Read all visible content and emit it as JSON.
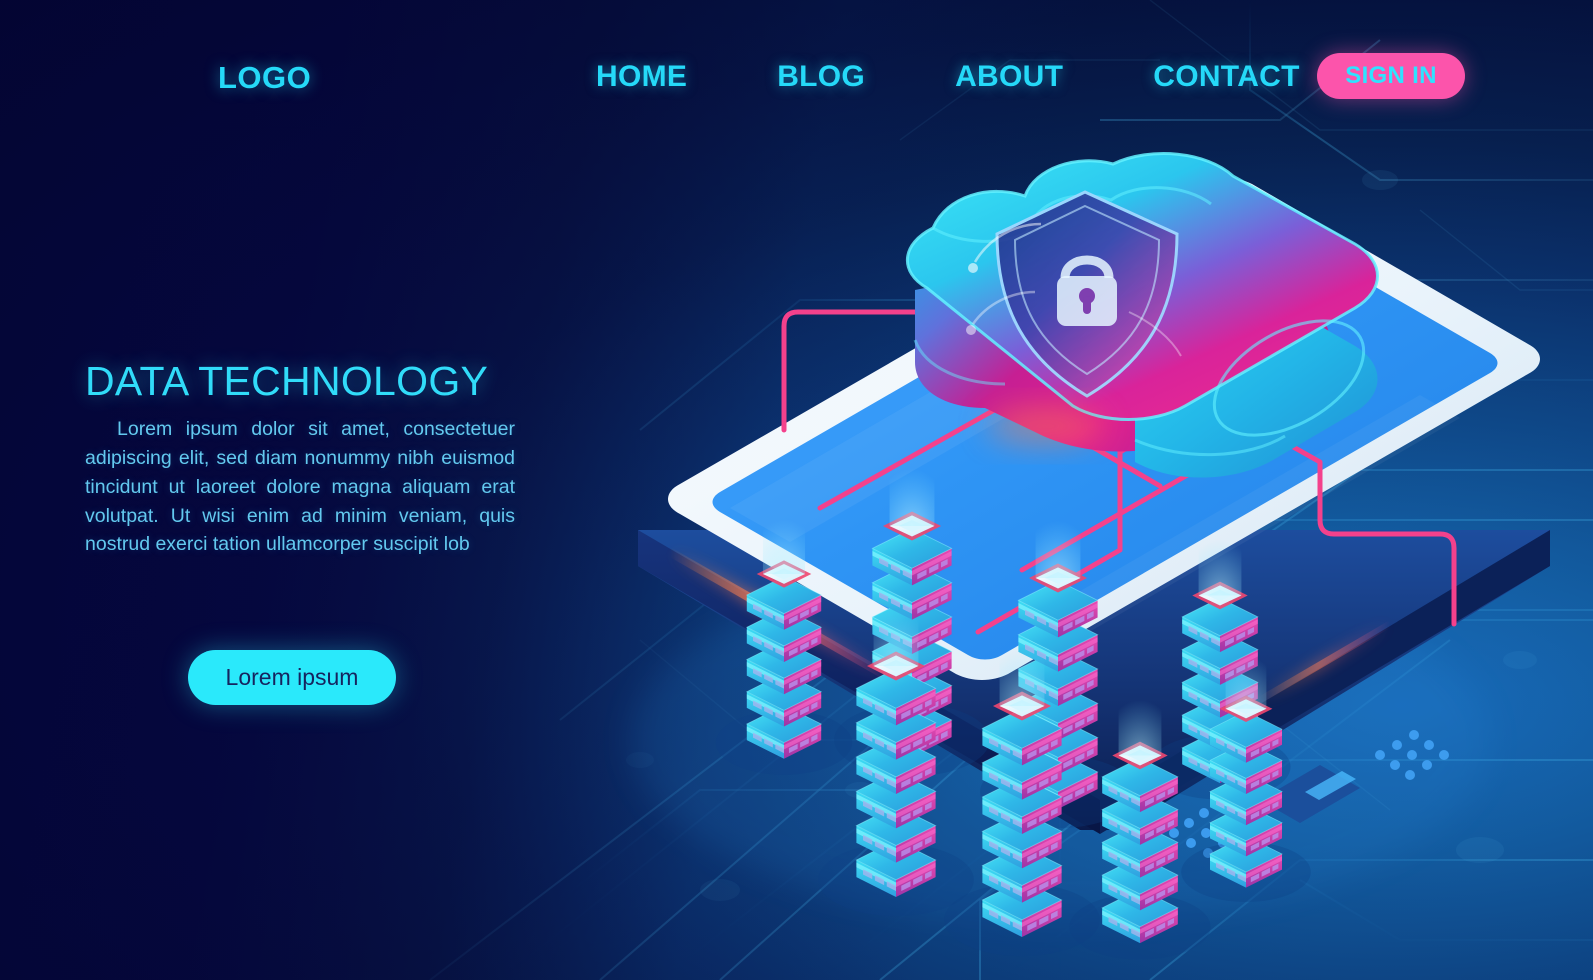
{
  "brand": {
    "logo": "LOGO",
    "accent_cyan": "#25d9f8",
    "accent_pink": "#fc54ab",
    "bg_navy": "#050a46"
  },
  "nav": {
    "items": [
      {
        "label": "HOME"
      },
      {
        "label": "BLOG"
      },
      {
        "label": "ABOUT"
      },
      {
        "label": "CONTACT"
      }
    ],
    "signin_label": "SIGN IN"
  },
  "hero": {
    "headline": "DATA TECHNOLOGY",
    "paragraph": "Lorem ipsum dolor sit amet, consectetuer adipiscing elit, sed diam nonummy nibh euismod tincidunt ut laoreet dolore magna aliquam erat volutpat. Ut wisi enim ad minim veniam, quis nostrud exerci tation ullamcorper suscipit lob",
    "cta_label": "Lorem ipsum"
  },
  "illustration": {
    "name": "isometric-cloud-server-phone",
    "cloud": {
      "name": "secure-cloud",
      "badge": "shield-lock-icon"
    },
    "device": {
      "name": "smartphone"
    },
    "server_racks": [
      {
        "id": 1,
        "tiers": 5
      },
      {
        "id": 2,
        "tiers": 6
      },
      {
        "id": 3,
        "tiers": 6
      },
      {
        "id": 4,
        "tiers": 6
      },
      {
        "id": 5,
        "tiers": 6
      },
      {
        "id": 6,
        "tiers": 6
      },
      {
        "id": 7,
        "tiers": 5
      },
      {
        "id": 8,
        "tiers": 5
      }
    ],
    "connector_color": "#f4418c"
  }
}
